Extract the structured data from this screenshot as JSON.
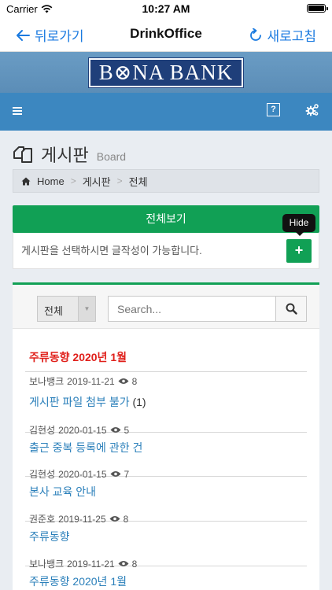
{
  "status": {
    "carrier": "Carrier",
    "time": "10:27 AM"
  },
  "nav": {
    "back": "뒤로가기",
    "title": "DrinkOffice",
    "refresh": "새로고침"
  },
  "banner": {
    "logo": "B⊗NA BANK"
  },
  "toolbar": {
    "help": "?"
  },
  "page": {
    "title": "게시판",
    "subtitle": "Board"
  },
  "breadcrumb": {
    "home": "Home",
    "board": "게시판",
    "current": "전체",
    "sep": ">"
  },
  "actions": {
    "view_all": "전체보기",
    "tooltip": "Hide",
    "notice": "게시판을 선택하시면 글작성이 가능합니다.",
    "add": "+"
  },
  "filter": {
    "selected": "전체",
    "search_placeholder": "Search..."
  },
  "board": {
    "category": "주류동향 2020년 1월",
    "posts": [
      {
        "author": "보나뱅크",
        "date": "2019-11-21",
        "views": "8",
        "title": "게시판 파일 첨부 불가",
        "count": "(1)"
      },
      {
        "author": "김현성",
        "date": "2020-01-15",
        "views": "5",
        "title": "출근 중복 등록에 관한 건",
        "count": ""
      },
      {
        "author": "김현성",
        "date": "2020-01-15",
        "views": "7",
        "title": "본사 교육 안내",
        "count": ""
      },
      {
        "author": "권준호",
        "date": "2019-11-25",
        "views": "8",
        "title": "주류동향",
        "count": ""
      },
      {
        "author": "보나뱅크",
        "date": "2019-11-21",
        "views": "8",
        "title": "주류동향 2020년 1월",
        "count": ""
      }
    ]
  },
  "colors": {
    "accent": "#11a055",
    "link": "#2a7fba",
    "category": "#e0201b",
    "toolbar": "#3c87c0",
    "nav_link": "#1a7ae0"
  }
}
